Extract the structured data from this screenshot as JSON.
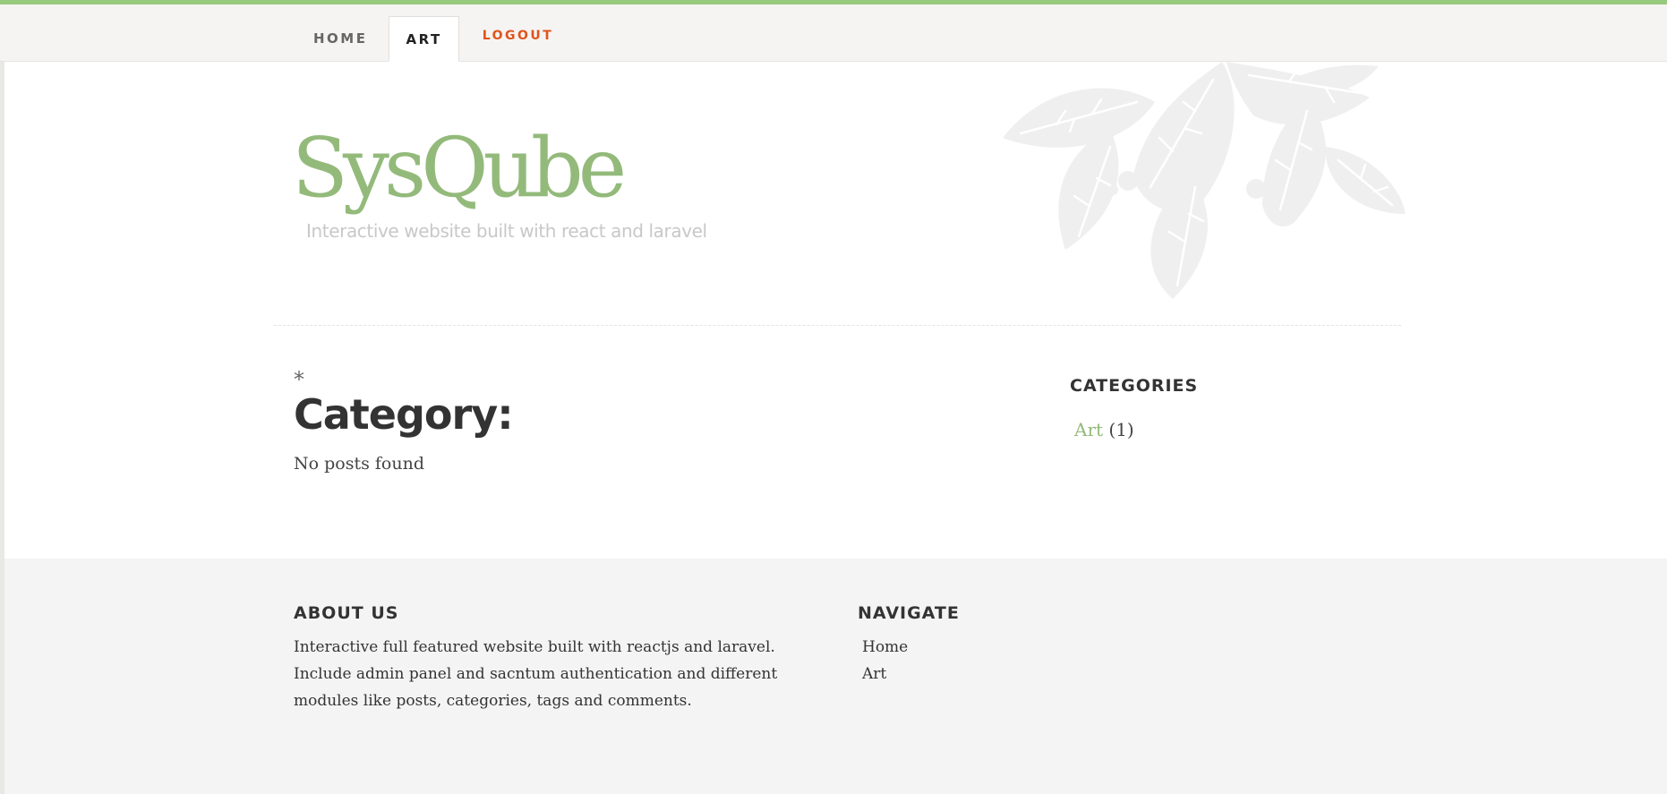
{
  "nav": {
    "items": [
      {
        "label": "HOME",
        "active": false
      },
      {
        "label": "ART",
        "active": true
      },
      {
        "label": "LOGOUT",
        "active": false
      }
    ]
  },
  "header": {
    "site_title": "SysQube",
    "tagline": "Interactive website built with react and laravel"
  },
  "main": {
    "marker": "*",
    "heading": "Category:",
    "empty_message": "No posts found"
  },
  "sidebar": {
    "categories_title": "CATEGORIES",
    "categories": [
      {
        "name": "Art",
        "count": "(1)"
      }
    ]
  },
  "footer": {
    "about_title": "ABOUT US",
    "about_text": "Interactive full featured website built with reactjs and laravel. Include admin panel and sacntum authentication and different modules like posts, categories, tags and comments.",
    "navigate_title": "NAVIGATE",
    "navigate_links": [
      "Home",
      "Art"
    ]
  },
  "colors": {
    "accent_green": "#93ba7a",
    "top_bar_green": "#97c97e",
    "logout_orange": "#e0531c"
  },
  "icons": {
    "header_decoration": "leaves-decoration-icon"
  }
}
